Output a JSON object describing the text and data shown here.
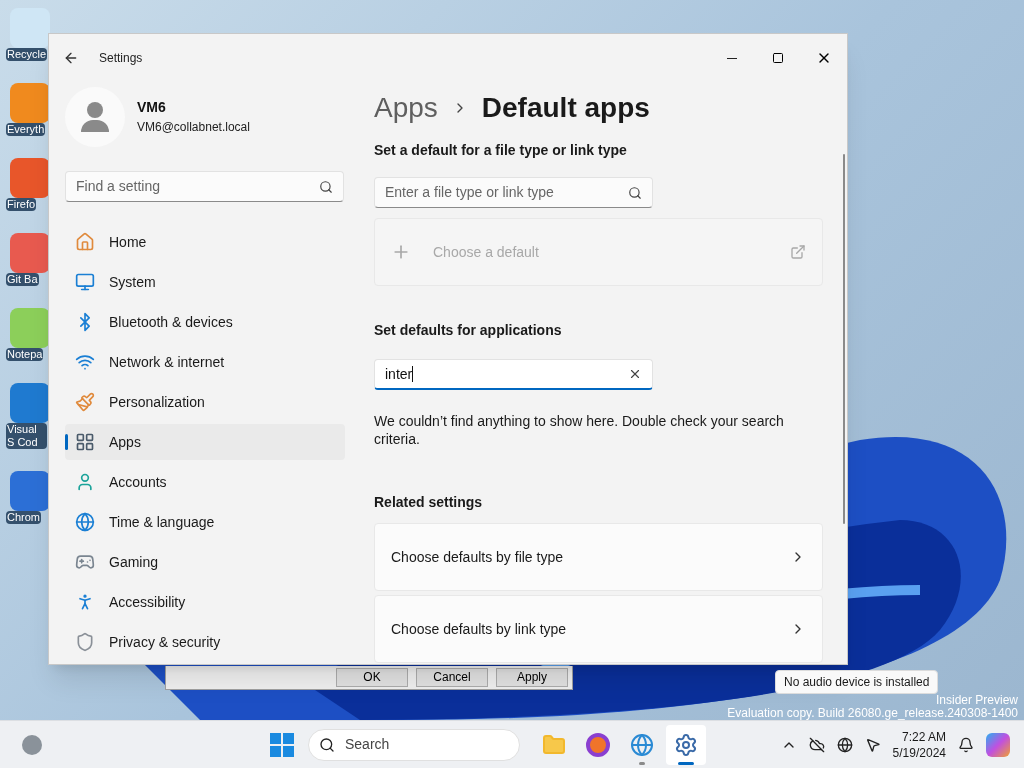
{
  "desktop": {
    "icons": [
      {
        "label": "Recycle"
      },
      {
        "label": "Everyth"
      },
      {
        "label": "Firefo"
      },
      {
        "label": "Git Ba"
      },
      {
        "label": "Notepa"
      },
      {
        "label": "Visual S Cod"
      },
      {
        "label": "Chrom"
      }
    ],
    "watermark": [
      "Insider Preview",
      "Evaluation copy. Build 26080.ge_release.240308-1400"
    ]
  },
  "dialog": {
    "buttons": [
      "OK",
      "Cancel",
      "Apply"
    ]
  },
  "settings": {
    "title": "Settings",
    "user": {
      "name": "VM6",
      "email": "VM6@collabnet.local"
    },
    "search": {
      "placeholder": "Find a setting"
    },
    "nav": [
      {
        "label": "Home",
        "selected": false
      },
      {
        "label": "System",
        "selected": false
      },
      {
        "label": "Bluetooth & devices",
        "selected": false
      },
      {
        "label": "Network & internet",
        "selected": false
      },
      {
        "label": "Personalization",
        "selected": false
      },
      {
        "label": "Apps",
        "selected": true
      },
      {
        "label": "Accounts",
        "selected": false
      },
      {
        "label": "Time & language",
        "selected": false
      },
      {
        "label": "Gaming",
        "selected": false
      },
      {
        "label": "Accessibility",
        "selected": false
      },
      {
        "label": "Privacy & security",
        "selected": false
      }
    ],
    "breadcrumb": {
      "parent": "Apps",
      "current": "Default apps"
    },
    "file_type": {
      "heading": "Set a default for a file type or link type",
      "placeholder": "Enter a file type or link type",
      "choose_default": "Choose a default",
      "disabled": true
    },
    "applications": {
      "heading": "Set defaults for applications",
      "value": "inter",
      "message": "We couldn’t find anything to show here. Double check your search criteria."
    },
    "related": {
      "heading": "Related settings",
      "items": [
        {
          "label": "Choose defaults by file type"
        },
        {
          "label": "Choose defaults by link type"
        }
      ]
    }
  },
  "tooltip": "No audio device is installed",
  "taskbar": {
    "search": {
      "placeholder": "Search"
    },
    "apps": [
      {
        "kind": "folder",
        "running": false,
        "selected": false
      },
      {
        "kind": "browser",
        "running": false,
        "selected": false
      },
      {
        "kind": "network-app",
        "running": true,
        "selected": false
      },
      {
        "kind": "settings",
        "running": true,
        "selected": true
      }
    ],
    "time": "7:22 AM",
    "date": "5/19/2024"
  }
}
